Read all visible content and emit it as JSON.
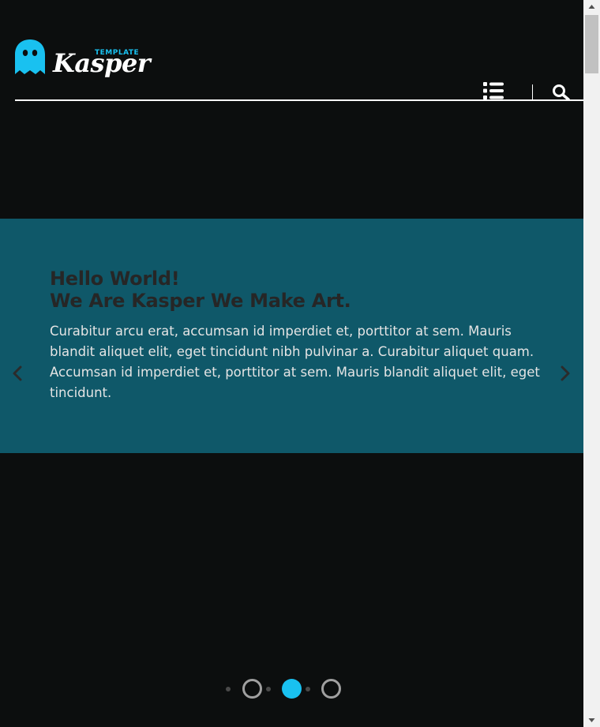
{
  "header": {
    "logo": {
      "tag": "TEMPLATE",
      "brand": "Kasper",
      "icon": "ghost-icon"
    },
    "menu_icon": "list-icon",
    "search_icon": "search-icon"
  },
  "slide": {
    "heading_line1": "Hello World!",
    "heading_line2": "We Are Kasper We Make Art.",
    "paragraph": "Curabitur arcu erat, accumsan id imperdiet et, porttitor at sem. Mauris blandit aliquet elit, eget tincidunt nibh pulvinar a. Curabitur aliquet quam. Accumsan id imperdiet et, porttitor at sem. Mauris blandit aliquet elit, eget tincidunt."
  },
  "slider": {
    "prev_icon": "chevron-left-icon",
    "next_icon": "chevron-right-icon",
    "slide_count": 3,
    "active_slide": 2
  },
  "colors": {
    "accent": "#19c1f0",
    "slide_bg": "#0f5869",
    "page_bg": "#0c0e0e",
    "heading": "#262626"
  }
}
